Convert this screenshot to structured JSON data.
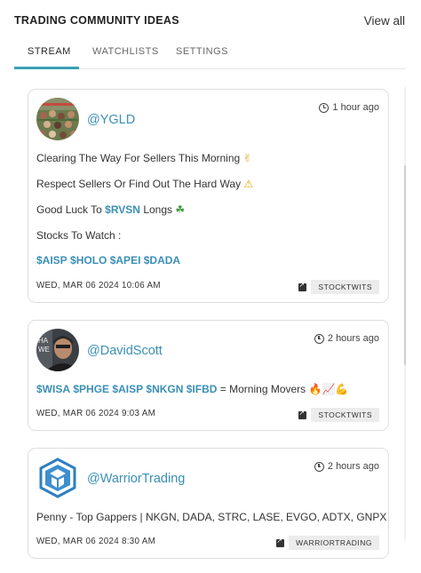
{
  "header": {
    "title": "TRADING COMMUNITY IDEAS",
    "view_all": "View all"
  },
  "tabs": [
    {
      "label": "STREAM",
      "active": true
    },
    {
      "label": "WATCHLISTS",
      "active": false
    },
    {
      "label": "SETTINGS",
      "active": false
    }
  ],
  "accent_color": "#3aa0b6",
  "link_color": "#3a8fb7",
  "posts": [
    {
      "handle": "@YGLD",
      "time": "1 hour ago",
      "lines": {
        "l1": "Clearing The Way For Sellers This Morning",
        "l1_emoji": "✌",
        "l2": "Respect Sellers Or Find Out The Hard Way",
        "l2_emoji": "⚠",
        "l3_prefix": "Good Luck To",
        "l3_ticker": "$RVSN",
        "l3_suffix": "Longs",
        "l3_emoji": "☘",
        "l4": "Stocks To Watch :",
        "tickers": [
          "$AISP",
          "$HOLO",
          "$APEI",
          "$DADA"
        ]
      },
      "date": "WED, MAR 06 2024 10:06 AM",
      "source": "STOCKTWITS",
      "avatar": "crowd-photo"
    },
    {
      "handle": "@DavidScott",
      "time": "2 hours ago",
      "tickers": [
        "$WISA",
        "$PHGE",
        "$AISP",
        "$NKGN",
        "$IFBD"
      ],
      "text": "= Morning Movers",
      "emojis": "🔥📈💪",
      "date": "WED, MAR 06 2024 9:03 AM",
      "source": "STOCKTWITS",
      "avatar": "portrait-photo"
    },
    {
      "handle": "@WarriorTrading",
      "time": "2 hours ago",
      "text": "Penny - Top Gappers | NKGN, DADA, STRC, LASE, EVGO, ADTX, GNPX",
      "date": "WED, MAR 06 2024 8:30 AM",
      "source": "WARRIORTRADING",
      "avatar": "warrior-logo"
    }
  ]
}
